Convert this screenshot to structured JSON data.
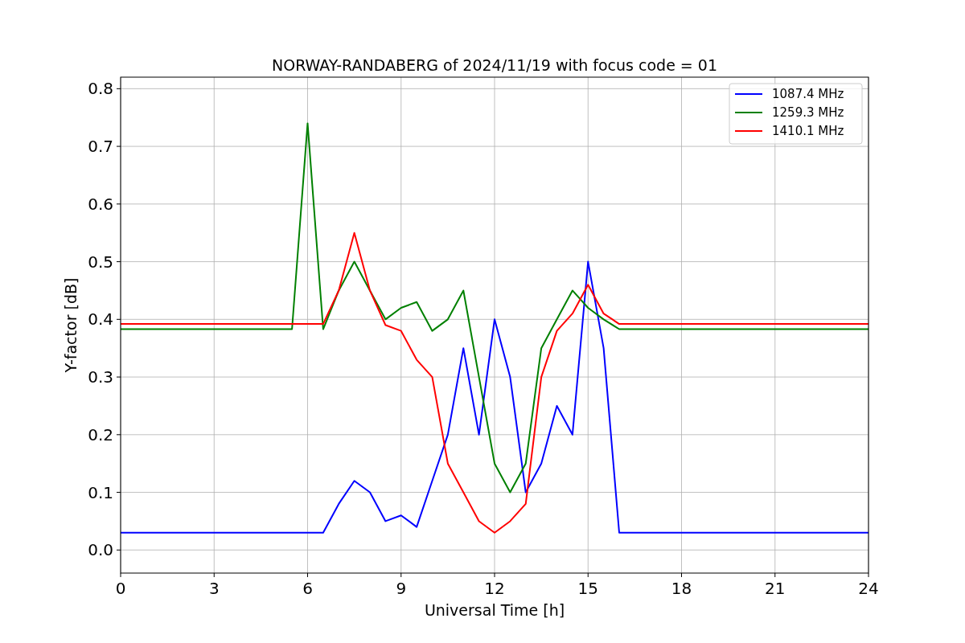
{
  "figure": {
    "chart_data": {
      "type": "line",
      "title": "NORWAY-RANDABERG of 2024/11/19 with focus code = 01",
      "xlabel": "Universal Time [h]",
      "ylabel": "Y-factor [dB]",
      "xlim": [
        0,
        24
      ],
      "ylim": [
        -0.04,
        0.82
      ],
      "grid": true,
      "legend": true,
      "xticks": [
        0,
        3,
        6,
        9,
        12,
        15,
        18,
        21,
        24
      ],
      "yticks": [
        {
          "value": 0,
          "label": "0.0"
        },
        {
          "value": 0.1,
          "label": "0.1"
        },
        {
          "value": 0.2,
          "label": "0.2"
        },
        {
          "value": 0.3,
          "label": "0.3"
        },
        {
          "value": 0.4,
          "label": "0.4"
        },
        {
          "value": 0.5,
          "label": "0.5"
        },
        {
          "value": 0.6,
          "label": "0.6"
        },
        {
          "value": 0.7,
          "label": "0.7"
        },
        {
          "value": 0.8,
          "label": "0.8"
        }
      ],
      "x": [
        0,
        0.5,
        1,
        1.5,
        2,
        2.5,
        3,
        3.5,
        4,
        4.5,
        5,
        5.5,
        6,
        6.5,
        7,
        7.5,
        8,
        8.5,
        9,
        9.5,
        10,
        10.5,
        11,
        11.5,
        12,
        12.5,
        13,
        13.5,
        14,
        14.5,
        15,
        15.5,
        16,
        16.5,
        17,
        17.5,
        18,
        18.5,
        19,
        19.5,
        20,
        20.5,
        21,
        21.5,
        22,
        22.5,
        23,
        23.5,
        24
      ],
      "series": [
        {
          "name": "1087.4 MHz",
          "color": "#0000ff",
          "values": [
            0.03,
            0.03,
            0.03,
            0.03,
            0.03,
            0.03,
            0.03,
            0.03,
            0.03,
            0.03,
            0.03,
            0.03,
            0.03,
            0.03,
            0.08,
            0.12,
            0.1,
            0.05,
            0.06,
            0.04,
            0.12,
            0.2,
            0.35,
            0.2,
            0.4,
            0.3,
            0.1,
            0.15,
            0.25,
            0.2,
            0.5,
            0.35,
            0.03,
            0.03,
            0.03,
            0.03,
            0.03,
            0.03,
            0.03,
            0.03,
            0.03,
            0.03,
            0.03,
            0.03,
            0.03,
            0.03,
            0.03,
            0.03,
            0.03
          ]
        },
        {
          "name": "1259.3 MHz",
          "color": "#008000",
          "values": [
            0.383,
            0.383,
            0.383,
            0.383,
            0.383,
            0.383,
            0.383,
            0.383,
            0.383,
            0.383,
            0.383,
            0.383,
            0.74,
            0.383,
            0.45,
            0.5,
            0.45,
            0.4,
            0.42,
            0.43,
            0.38,
            0.4,
            0.45,
            0.3,
            0.15,
            0.1,
            0.15,
            0.35,
            0.4,
            0.45,
            0.42,
            0.4,
            0.383,
            0.383,
            0.383,
            0.383,
            0.383,
            0.383,
            0.383,
            0.383,
            0.383,
            0.383,
            0.383,
            0.383,
            0.383,
            0.383,
            0.383,
            0.383,
            0.383
          ]
        },
        {
          "name": "1410.1 MHz",
          "color": "#ff0000",
          "values": [
            0.392,
            0.392,
            0.392,
            0.392,
            0.392,
            0.392,
            0.392,
            0.392,
            0.392,
            0.392,
            0.392,
            0.392,
            0.392,
            0.392,
            0.45,
            0.55,
            0.45,
            0.39,
            0.38,
            0.33,
            0.3,
            0.15,
            0.1,
            0.05,
            0.03,
            0.05,
            0.08,
            0.3,
            0.38,
            0.41,
            0.46,
            0.41,
            0.392,
            0.392,
            0.392,
            0.392,
            0.392,
            0.392,
            0.392,
            0.392,
            0.392,
            0.392,
            0.392,
            0.392,
            0.392,
            0.392,
            0.392,
            0.392,
            0.392
          ]
        }
      ]
    }
  }
}
